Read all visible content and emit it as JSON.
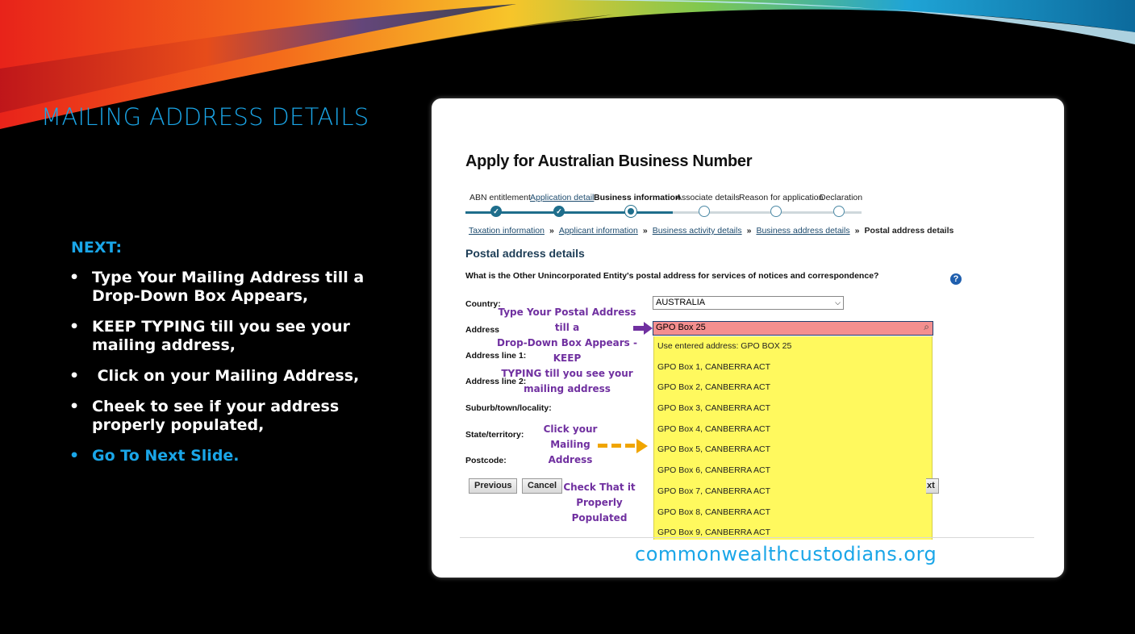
{
  "slide": {
    "title": "MAILING ADDRESS DETAILS",
    "next_heading": "NEXT:",
    "bullets": [
      "Type Your Mailing Address till a Drop-Down Box Appears,",
      "KEEP TYPING till you see your mailing address,",
      " Click on your Mailing Address,",
      "Cheek to see if your address properly populated,",
      "Go To Next Slide."
    ],
    "website": "commonwealthcustodians.org"
  },
  "form": {
    "title": "Apply for Australian Business Number",
    "steps": [
      {
        "label": "ABN entitlement",
        "state": "done"
      },
      {
        "label": "Application detail",
        "state": "done"
      },
      {
        "label": "Business information",
        "state": "current"
      },
      {
        "label": "Associate details",
        "state": "todo"
      },
      {
        "label": "Reason for application",
        "state": "todo"
      },
      {
        "label": "Declaration",
        "state": "todo"
      }
    ],
    "breadcrumb": [
      "Taxation information",
      "Applicant information",
      "Business activity details",
      "Business address details",
      "Postal address details"
    ],
    "breadcrumb_sep": "»",
    "section_heading": "Postal address details",
    "question": "What is the Other Unincorporated Entity's postal address for services of notices and correspondence?",
    "labels": {
      "country": "Country:",
      "address": "Address",
      "line1": "Address line 1:",
      "line2": "Address line 2:",
      "suburb": "Suburb/town/locality:",
      "state": "State/territory:",
      "postcode": "Postcode:"
    },
    "country_value": "AUSTRALIA",
    "address_value": "GPO Box 25",
    "dropdown_items": [
      "Use entered address: GPO BOX 25",
      "GPO Box 1, CANBERRA ACT",
      "GPO Box 2, CANBERRA ACT",
      "GPO Box 3, CANBERRA ACT",
      "GPO Box 4, CANBERRA ACT",
      "GPO Box 5, CANBERRA ACT",
      "GPO Box 6, CANBERRA ACT",
      "GPO Box 7, CANBERRA ACT",
      "GPO Box 8, CANBERRA ACT",
      "GPO Box 9, CANBERRA ACT"
    ],
    "buttons": {
      "previous": "Previous",
      "cancel": "Cancel",
      "next_partial": "xt"
    }
  },
  "annotations": {
    "type_note": [
      "Type Your Postal Address till a",
      "Drop-Down Box Appears - KEEP",
      "TYPING till you see your",
      "mailing address"
    ],
    "click_note": [
      "Click your Mailing",
      "Address"
    ],
    "check_note": [
      "Check That it",
      "Properly",
      "Populated"
    ]
  },
  "colors": {
    "accent_blue": "#1aa6e8",
    "annotation_purple": "#7030a0",
    "dropdown_yellow": "#fff95e",
    "input_error_red": "#f48f8f",
    "arrow_orange": "#f0a500"
  }
}
